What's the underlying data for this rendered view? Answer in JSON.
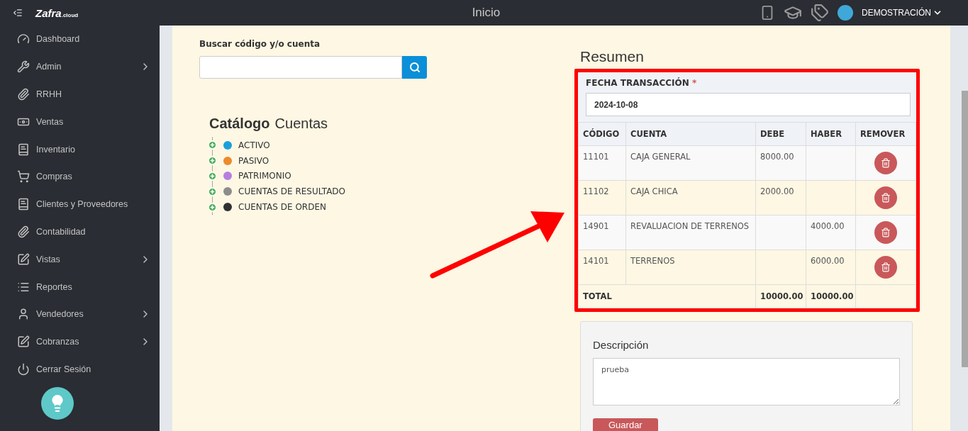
{
  "topbar": {
    "logo": {
      "name": "Zafra",
      "suffix": ".cloud"
    },
    "title": "Inicio",
    "user": "DEMOSTRACIÓN"
  },
  "sidebar": {
    "items": [
      {
        "label": "Dashboard",
        "has_submenu": false
      },
      {
        "label": "Admin",
        "has_submenu": true
      },
      {
        "label": "RRHH",
        "has_submenu": false
      },
      {
        "label": "Ventas",
        "has_submenu": false
      },
      {
        "label": "Inventario",
        "has_submenu": false
      },
      {
        "label": "Compras",
        "has_submenu": false
      },
      {
        "label": "Clientes y Proveedores",
        "has_submenu": false
      },
      {
        "label": "Contabilidad",
        "has_submenu": false
      },
      {
        "label": "Vistas",
        "has_submenu": true
      },
      {
        "label": "Reportes",
        "has_submenu": false
      },
      {
        "label": "Vendedores",
        "has_submenu": true
      },
      {
        "label": "Cobranzas",
        "has_submenu": true
      },
      {
        "label": "Cerrar Sesión",
        "has_submenu": false
      }
    ]
  },
  "search": {
    "label": "Buscar código y/o cuenta"
  },
  "catalog": {
    "title_bold": "Catálogo",
    "title_rest": "Cuentas",
    "items": [
      {
        "label": "ACTIVO",
        "color": "#1a9fdc",
        "expanded": false
      },
      {
        "label": "PASIVO",
        "color": "#ec8a2c",
        "expanded": false
      },
      {
        "label": "PATRIMONIO",
        "color": "#b57fe0",
        "expanded": false
      },
      {
        "label": "CUENTAS DE RESULTADO",
        "color": "#8c8c8c",
        "expanded": false
      },
      {
        "label": "CUENTAS DE ORDEN",
        "color": "#2f3033",
        "expanded": false
      }
    ]
  },
  "summary": {
    "title": "Resumen",
    "date_label": "FECHA TRANSACCIÓN",
    "required_mark": "*",
    "date": "2024-10-08",
    "columns": [
      "CÓDIGO",
      "CUENTA",
      "DEBE",
      "HABER",
      "REMOVER"
    ],
    "rows": [
      {
        "code": "11101",
        "account": "CAJA GENERAL",
        "debit": "8000.00",
        "credit": ""
      },
      {
        "code": "11102",
        "account": "CAJA CHICA",
        "debit": "2000.00",
        "credit": ""
      },
      {
        "code": "14901",
        "account": "REVALUACION DE TERRENOS",
        "debit": "",
        "credit": "4000.00"
      },
      {
        "code": "14101",
        "account": "TERRENOS",
        "debit": "",
        "credit": "6000.00"
      }
    ],
    "total": {
      "label": "TOTAL",
      "debit": "10000.00",
      "credit": "10000.00"
    }
  },
  "description": {
    "label": "Descripción",
    "value": "prueba",
    "button": "Guardar"
  }
}
